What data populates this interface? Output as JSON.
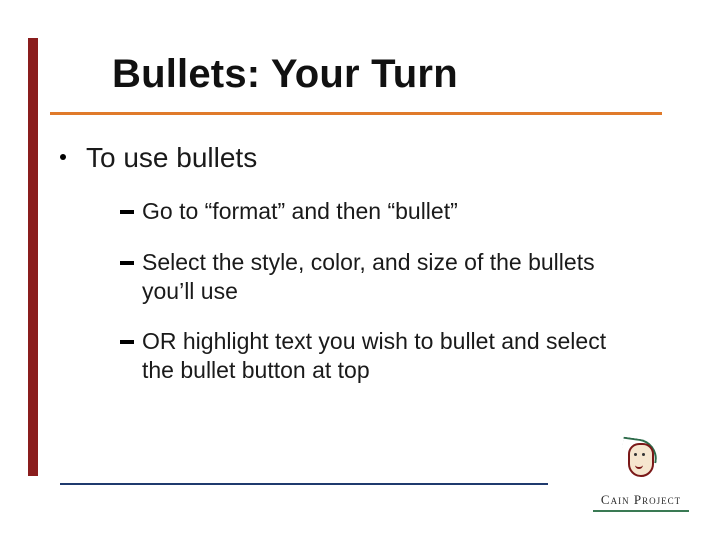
{
  "title": "Bullets: Your Turn",
  "body": {
    "lvl1": "To use bullets",
    "lvl2": [
      "Go to “format” and then “bullet”",
      "Select the style, color, and size of the bullets you’ll use",
      "OR highlight text you wish to bullet and select the bullet button at top"
    ]
  },
  "logo": {
    "text": "Cain Project"
  },
  "colors": {
    "stripe": "#8a1d1d",
    "underline": "#e07a2a",
    "bottom_line": "#1f3a6e",
    "logo_green": "#3a7a54"
  }
}
